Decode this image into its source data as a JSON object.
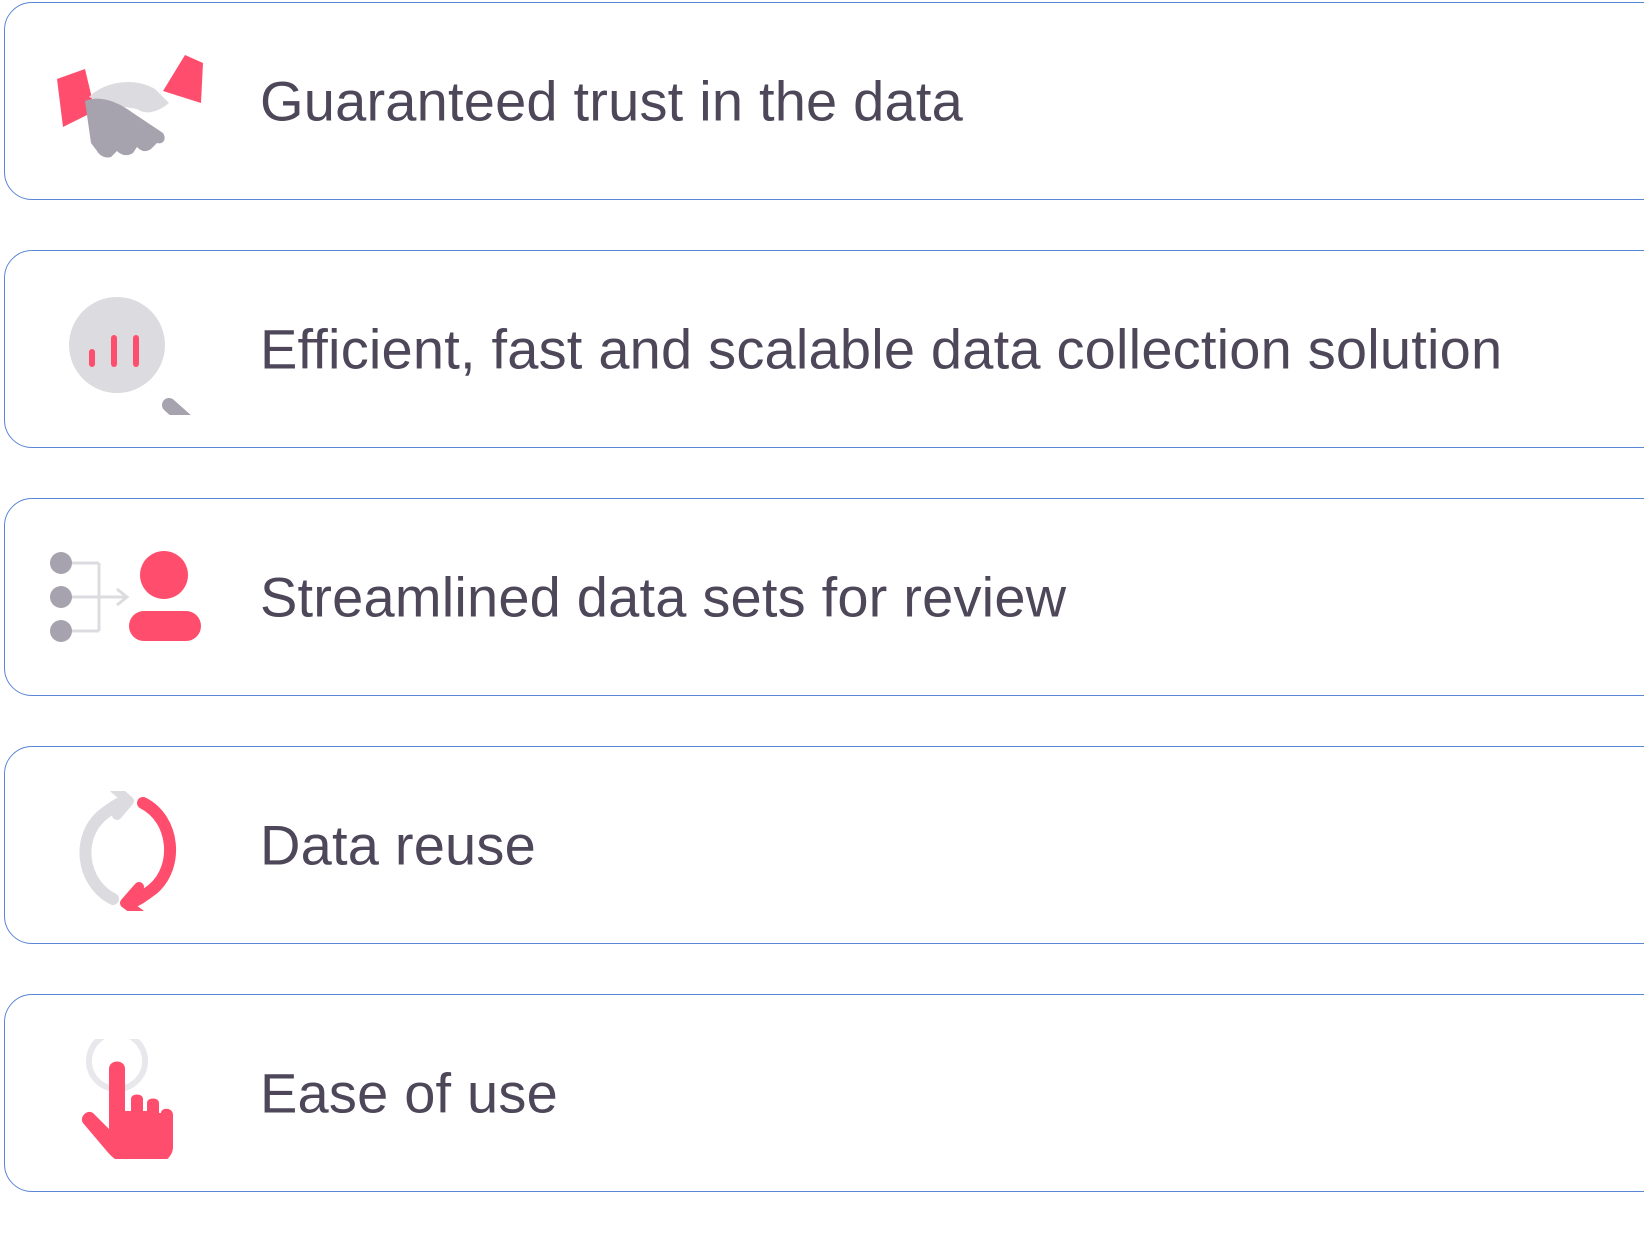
{
  "colors": {
    "accent": "#ff4d6d",
    "icon_gray": "#a7a3ae",
    "icon_light_gray": "#dcdce0",
    "text": "#4d4759",
    "border": "#5b86d6"
  },
  "features": [
    {
      "icon": "handshake-icon",
      "label": "Guaranteed trust in the data"
    },
    {
      "icon": "magnifier-chart-icon",
      "label": "Efficient, fast and scalable data collection solution"
    },
    {
      "icon": "data-to-person-icon",
      "label": "Streamlined data sets for review"
    },
    {
      "icon": "refresh-cycle-icon",
      "label": "Data reuse"
    },
    {
      "icon": "pointer-hand-icon",
      "label": "Ease of use"
    }
  ]
}
